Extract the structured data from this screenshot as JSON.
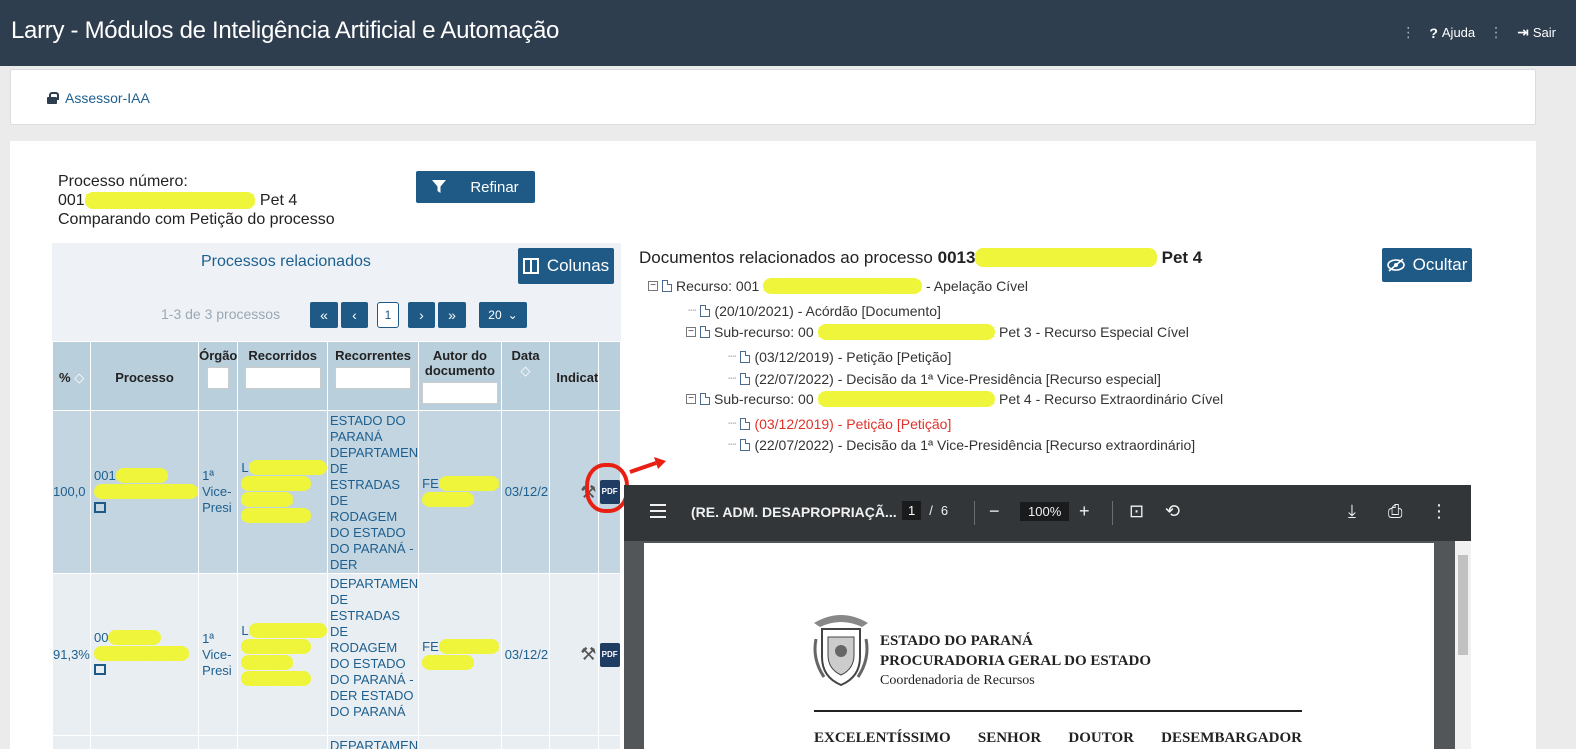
{
  "app": {
    "title": "Larry - Módulos de Inteligência Artificial e Automação",
    "help_label": "Ajuda",
    "logout_label": "Sair"
  },
  "breadcrumb": {
    "label": "Assessor-IAA"
  },
  "process": {
    "label": "Processo número:",
    "number_prefix": "001",
    "number_hidden": "XXXXXXXXXXXXXXXX",
    "number_suffix": "Pet 4",
    "comparing": "Comparando com Petição do processo"
  },
  "refine_button": "Refinar",
  "related": {
    "title": "Processos relacionados",
    "columns_button": "Colunas",
    "pager_text": "1-3 de 3 processos",
    "current_page": "1",
    "page_size": "20",
    "headers": [
      "%",
      "Processo",
      "Órgão",
      "Recorridos",
      "Recorrentes",
      "Autor do documento",
      "Data",
      "Indicat"
    ],
    "rows": [
      {
        "pct": "100,0",
        "processo": "001",
        "orgao": "1ª Vice-Presi",
        "recorridos": "L",
        "recorrentes": "ESTADO DO PARANÁ DEPARTAMEN DE ESTRADAS DE RODAGEM DO ESTADO DO PARANÁ - DER",
        "autor": "FE",
        "data": "03/12/2"
      },
      {
        "pct": "91,3%",
        "processo": "00",
        "orgao": "1ª Vice-Presi",
        "recorridos": "L",
        "recorrentes": "DEPARTAMEN DE ESTRADAS DE RODAGEM DO ESTADO DO PARANÁ - DER ESTADO DO PARANÁ",
        "autor": "FE",
        "data": "03/12/2"
      },
      {
        "pct": "",
        "processo": "",
        "orgao": "",
        "recorridos": "",
        "recorrentes": "DEPARTAMEN",
        "autor": "",
        "data": ""
      }
    ]
  },
  "documents": {
    "title_prefix": "Documentos relacionados ao processo",
    "title_number": "0013",
    "title_suffix": "Pet 4",
    "hide_button": "Ocultar",
    "tree": [
      {
        "text": "Recurso: 001",
        "tail": "- Apelação Cível"
      },
      {
        "text": "(20/10/2021) - Acórdão [Documento]"
      },
      {
        "text": "Sub-recurso: 00",
        "tail": "Pet 3 - Recurso Especial Cível"
      },
      {
        "text": "(03/12/2019) - Petição [Petição]"
      },
      {
        "text": "(22/07/2022) - Decisão da 1ª Vice-Presidência [Recurso especial]"
      },
      {
        "text": "Sub-recurso: 00",
        "tail": "Pet 4 - Recurso Extraordinário Cível"
      },
      {
        "text": "(03/12/2019) - Petição [Petição]"
      },
      {
        "text": "(22/07/2022) - Decisão da 1ª Vice-Presidência [Recurso extraordinário]"
      }
    ]
  },
  "pdf_viewer": {
    "title": "(RE. ADM. DESAPROPRIAÇÃ...",
    "page_current": "1",
    "page_total": "6",
    "zoom": "100%",
    "doc": {
      "line1": "ESTADO DO PARANÁ",
      "line2": "PROCURADORIA GERAL DO ESTADO",
      "line3": "Coordenadoria de Recursos",
      "salutation": [
        "EXCELENTÍSSIMO",
        "SENHOR",
        "DOUTOR",
        "DESEMBARGADOR"
      ]
    }
  },
  "colors": {
    "topbar": "#2f3e4e",
    "accent": "#1f5a86",
    "highlight": "#eef53a",
    "annotation_red": "#e82014"
  }
}
